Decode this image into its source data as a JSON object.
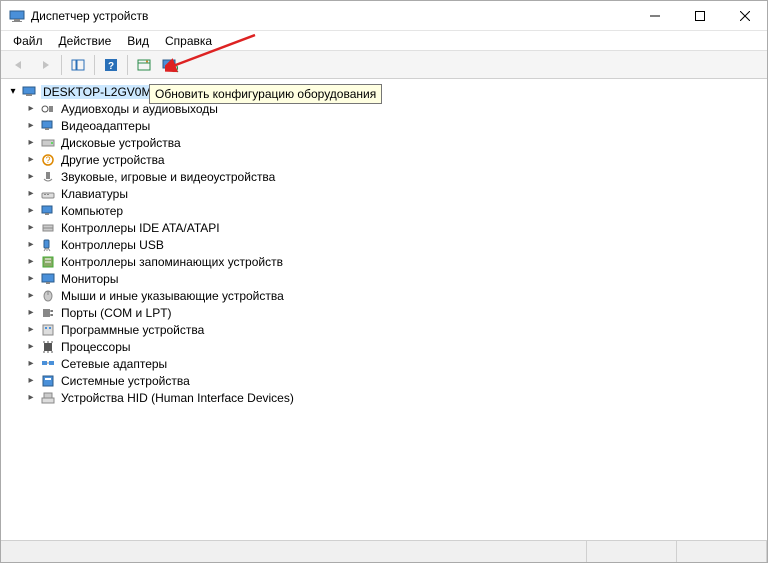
{
  "title": "Диспетчер устройств",
  "menu": {
    "file": "Файл",
    "action": "Действие",
    "view": "Вид",
    "help": "Справка"
  },
  "tooltip": "Обновить конфигурацию оборудования",
  "root": "DESKTOP-L2GV0M",
  "categories": [
    "Аудиовходы и аудиовыходы",
    "Видеоадаптеры",
    "Дисковые устройства",
    "Другие устройства",
    "Звуковые, игровые и видеоустройства",
    "Клавиатуры",
    "Компьютер",
    "Контроллеры IDE ATA/ATAPI",
    "Контроллеры USB",
    "Контроллеры запоминающих устройств",
    "Мониторы",
    "Мыши и иные указывающие устройства",
    "Порты (COM и LPT)",
    "Программные устройства",
    "Процессоры",
    "Сетевые адаптеры",
    "Системные устройства",
    "Устройства HID (Human Interface Devices)"
  ]
}
